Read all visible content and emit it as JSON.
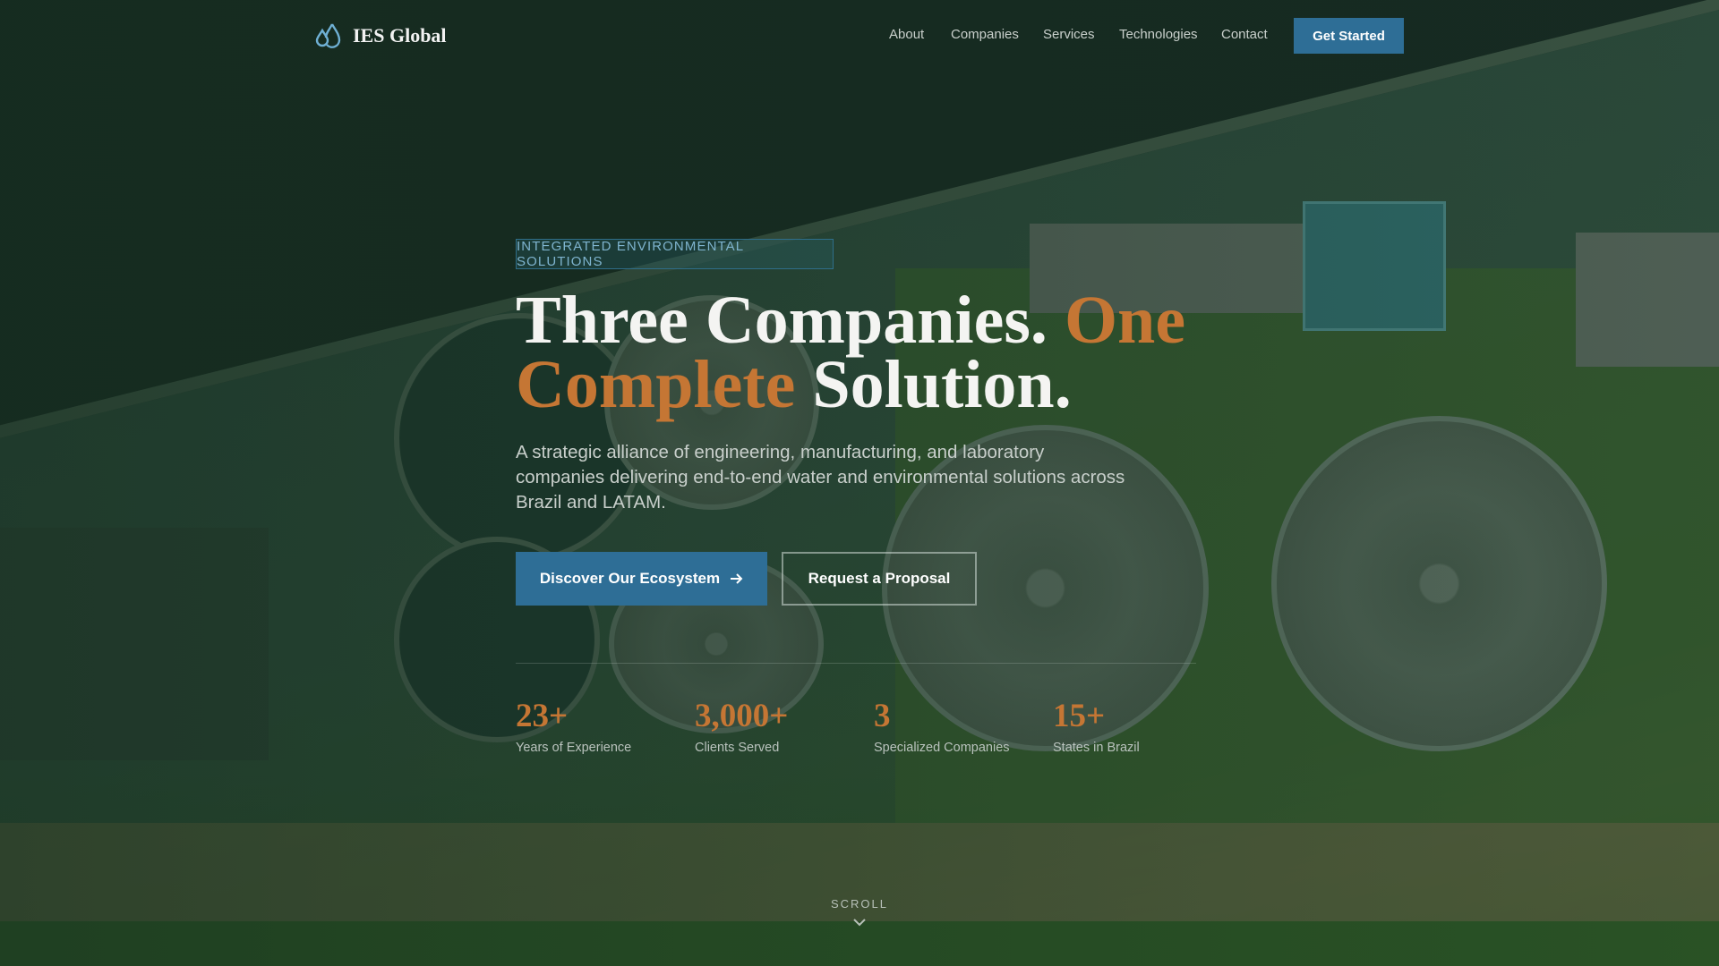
{
  "brand": {
    "name": "IES Global",
    "icon": "water-drops-icon"
  },
  "nav": {
    "links": [
      "About",
      "Companies",
      "Services",
      "Technologies",
      "Contact"
    ],
    "cta": "Get Started"
  },
  "hero": {
    "badge": "INTEGRATED ENVIRONMENTAL SOLUTIONS",
    "title_part1": "Three Companies. ",
    "title_accent": "One Complete",
    "title_part2": " Solution.",
    "lead": "A strategic alliance of engineering, manufacturing, and laboratory companies delivering end-to-end water and environmental solutions across Brazil and LATAM.",
    "primary_button": "Discover Our Ecosystem",
    "secondary_button": "Request a Proposal"
  },
  "stats": [
    {
      "value": "23+",
      "label": "Years of Experience"
    },
    {
      "value": "3,000+",
      "label": "Clients Served"
    },
    {
      "value": "3",
      "label": "Specialized Companies"
    },
    {
      "value": "15+",
      "label": "States in Brazil"
    }
  ],
  "scroll_label": "SCROLL",
  "colors": {
    "accent": "#c57634",
    "primary": "#2e6e96",
    "badge_text": "#7fb4cf"
  }
}
